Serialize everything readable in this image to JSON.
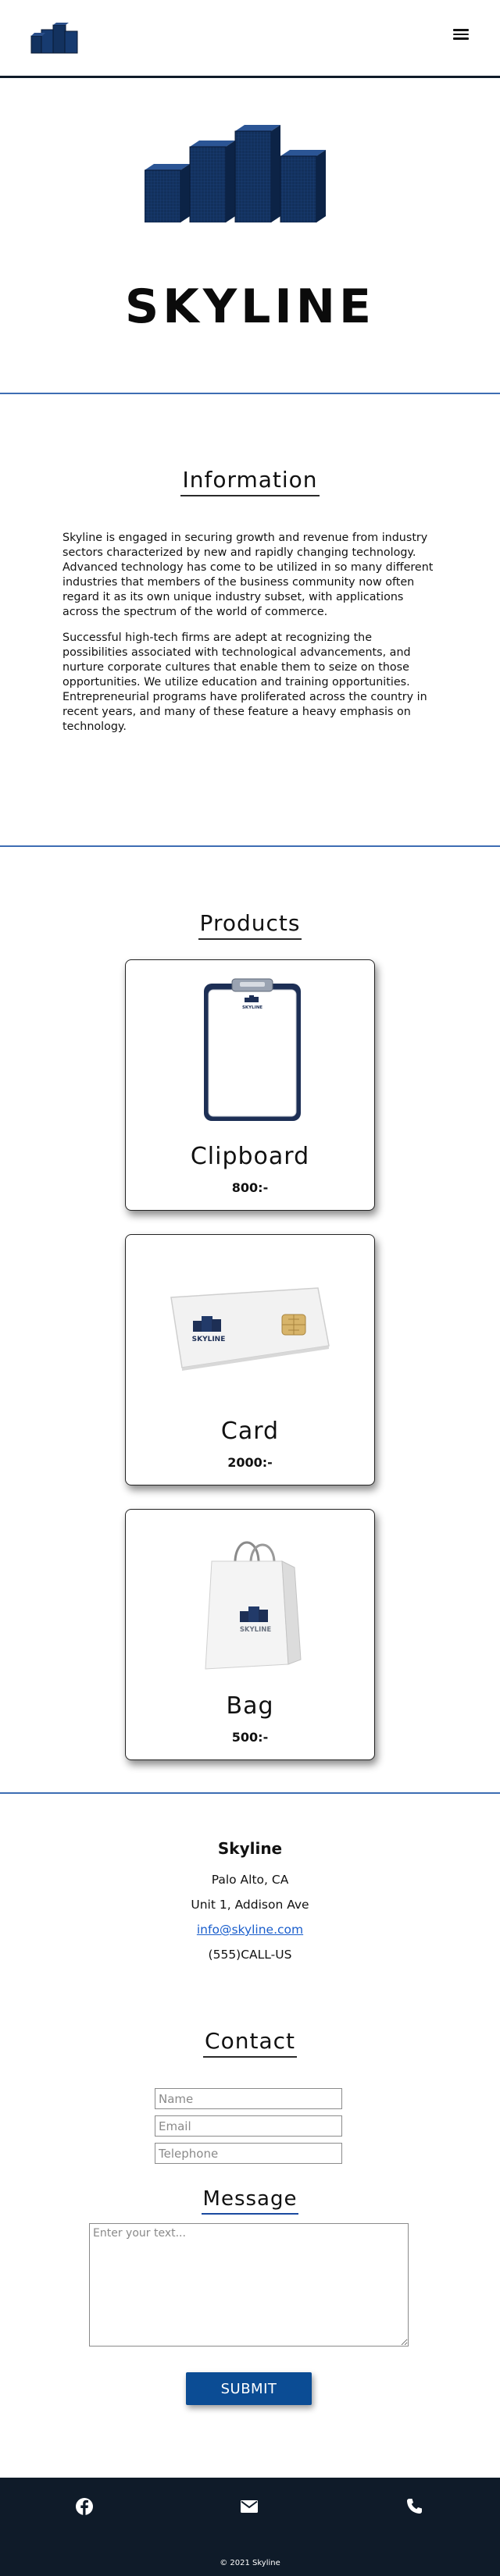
{
  "header": {
    "logo_icon": "skyline-buildings-icon",
    "menu_icon": "hamburger-menu-icon"
  },
  "hero": {
    "title": "SKYLINE"
  },
  "information": {
    "heading": "Information",
    "paragraphs": [
      "Skyline is engaged in securing growth and revenue from industry sectors characterized by new and rapidly changing technology. Advanced technology has come to be utilized in so many different industries that members of the business community now often regard it as its own unique industry subset, with applications across the spectrum of the world of commerce.",
      "Successful high-tech firms are adept at recognizing the possibilities associated with technological advancements, and nurture corporate cultures that enable them to seize on those opportunities. We utilize education and training opportunities. Entrepreneurial programs have proliferated across the country in recent years, and many of these feature a heavy emphasis on technology."
    ]
  },
  "products": {
    "heading": "Products",
    "items": [
      {
        "name": "Clipboard",
        "price": "800:-",
        "image": "clipboard-image",
        "brand_text": "SKYLINE"
      },
      {
        "name": "Card",
        "price": "2000:-",
        "image": "sim-card-image",
        "brand_text": "SKYLINE"
      },
      {
        "name": "Bag",
        "price": "500:-",
        "image": "shopping-bag-image",
        "brand_text": "SKYLINE"
      }
    ]
  },
  "address": {
    "name": "Skyline",
    "city": "Palo Alto, CA",
    "street": "Unit 1, Addison Ave",
    "email": "info@skyline.com",
    "phone": "(555)CALL-US"
  },
  "contact": {
    "heading": "Contact",
    "name_placeholder": "Name",
    "email_placeholder": "Email",
    "telephone_placeholder": "Telephone",
    "message_heading": "Message",
    "message_placeholder": "Enter your text...",
    "submit_label": "SUBMIT"
  },
  "footer": {
    "icons": [
      "facebook-icon",
      "mail-icon",
      "phone-icon"
    ],
    "copyright": "© 2021 Skyline"
  },
  "colors": {
    "navy": "#0f1b29",
    "accent_blue": "#3d6db3",
    "button_blue": "#0b4c94",
    "building_blue": "#13325f"
  }
}
